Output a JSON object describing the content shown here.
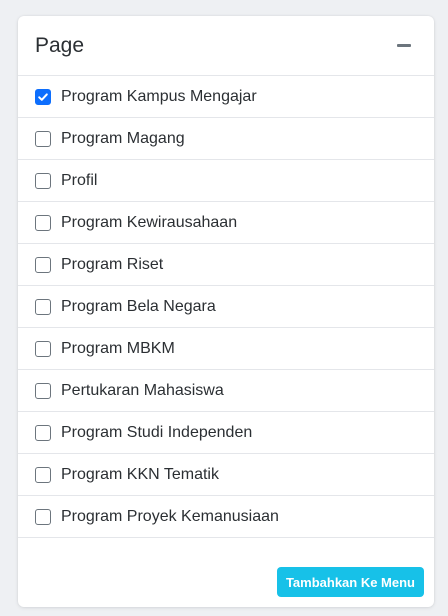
{
  "panel": {
    "title": "Page",
    "collapse_icon": "minus-icon"
  },
  "items": [
    {
      "label": "Program Kampus Mengajar",
      "checked": true
    },
    {
      "label": "Program Magang",
      "checked": false
    },
    {
      "label": "Profil",
      "checked": false
    },
    {
      "label": "Program Kewirausahaan",
      "checked": false
    },
    {
      "label": "Program Riset",
      "checked": false
    },
    {
      "label": "Program Bela Negara",
      "checked": false
    },
    {
      "label": "Program MBKM",
      "checked": false
    },
    {
      "label": "Pertukaran Mahasiswa",
      "checked": false
    },
    {
      "label": "Program Studi Independen",
      "checked": false
    },
    {
      "label": "Program KKN Tematik",
      "checked": false
    },
    {
      "label": "Program Proyek Kemanusiaan",
      "checked": false
    }
  ],
  "footer": {
    "add_button_label": "Tambahkan Ke Menu"
  },
  "colors": {
    "checkbox_checked": "#0d6efd",
    "button_bg": "#17c1e8"
  }
}
